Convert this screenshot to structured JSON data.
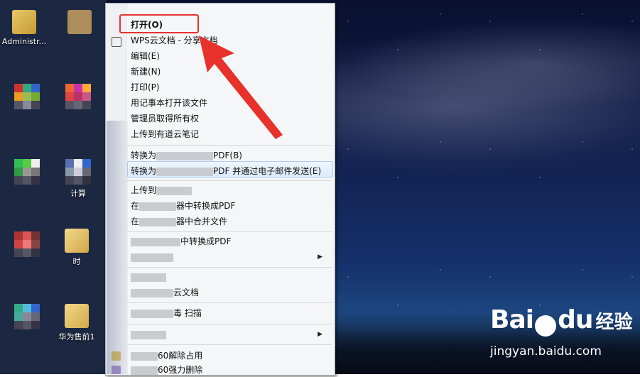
{
  "desktop": {
    "icons": [
      {
        "label": "Administr..."
      },
      {
        "label": "计算"
      },
      {
        "label": "时"
      },
      {
        "label": "华为售前1"
      }
    ]
  },
  "context_menu": {
    "items": [
      {
        "label": "打开(O)",
        "bold": true
      },
      {
        "label": "WPS云文档 - 分享文档"
      },
      {
        "label": "编辑(E)"
      },
      {
        "label": "新建(N)"
      },
      {
        "label": "打印(P)"
      },
      {
        "label": "用记事本打开该文件"
      },
      {
        "label": "管理员取得所有权"
      },
      {
        "label": "上传到有道云笔记"
      },
      {
        "label": "转换为",
        "label_tail": "PDF(B)"
      },
      {
        "label": "转换为",
        "label_tail": "PDF 并通过电子邮件发送(E)"
      },
      {
        "label": "上传到",
        "label_tail": ""
      },
      {
        "label": "在",
        "label_tail": "器中转换成PDF"
      },
      {
        "label": "在",
        "label_tail": "器中合并文件"
      },
      {
        "label": "在",
        "label_tail": "中转换成PDF"
      },
      {
        "label": ""
      },
      {
        "label": ""
      },
      {
        "label": "",
        "label_tail": "云文档"
      },
      {
        "label": "",
        "label_tail": "毒 扫描"
      },
      {
        "label": ""
      },
      {
        "label": "",
        "label_tail": "60解除占用"
      },
      {
        "label": "",
        "label_tail": "60强力删除"
      }
    ]
  },
  "watermark": {
    "logo_text": "Bai",
    "logo_text2": "du",
    "logo_cn": "经验",
    "url": "jingyan.baidu.com"
  },
  "colors": {
    "highlight_box": "#e63232",
    "menu_bg": "#f5f6f7",
    "hover_bg": "#dcebfc"
  }
}
